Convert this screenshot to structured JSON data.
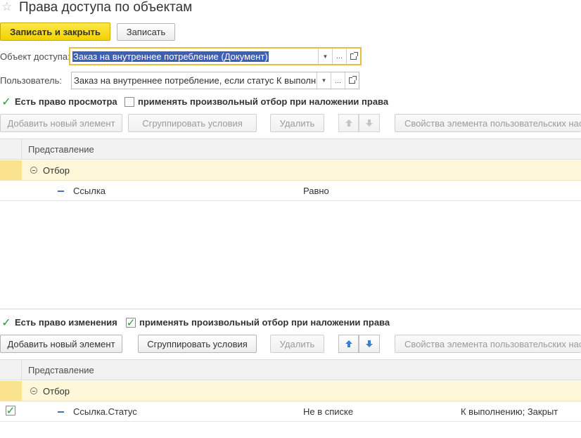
{
  "window": {
    "title": "Права доступа по объектам"
  },
  "toolbar": {
    "save_close_label": "Записать и закрыть",
    "save_label": "Записать"
  },
  "form": {
    "access_object": {
      "label": "Объект доступа:",
      "value": "Заказ на внутреннее потребление (Документ)",
      "dots": "..."
    },
    "user": {
      "label": "Пользователь:",
      "value": "Заказ на внутреннее потребление, если статус К выполн",
      "dots": "..."
    }
  },
  "view_section": {
    "right_checkbox": {
      "label": "Есть право просмотра",
      "checked": true
    },
    "filter_checkbox": {
      "label": "применять произвольный отбор при наложении права",
      "checked": false
    },
    "buttons": {
      "add": "Добавить новый элемент",
      "group": "Сгруппировать условия",
      "delete": "Удалить",
      "properties": "Свойства элемента пользовательских нас"
    },
    "table": {
      "header": "Представление",
      "group_label": "Отбор",
      "rows": [
        {
          "field": "Ссылка",
          "comparison": "Равно",
          "value": ""
        }
      ]
    }
  },
  "edit_section": {
    "right_checkbox": {
      "label": "Есть право изменения",
      "checked": true
    },
    "filter_checkbox": {
      "label": "применять произвольный отбор при наложении права",
      "checked": true
    },
    "buttons": {
      "add": "Добавить новый элемент",
      "group": "Сгруппировать условия",
      "delete": "Удалить",
      "properties": "Свойства элемента пользовательских нас"
    },
    "table": {
      "header": "Представление",
      "group_label": "Отбор",
      "rows": [
        {
          "field": "Ссылка.Статус",
          "comparison": "Не в списке",
          "value": "К выполнению; Закрыт",
          "checked": true
        }
      ]
    }
  },
  "colors": {
    "primary_button": "#f3d000",
    "focus_border": "#e6bf3e",
    "selection": "#3d5fb6",
    "check": "#2a9a3a",
    "group_row": "#fff8d8",
    "arrow_active": "#3a7fd0"
  }
}
